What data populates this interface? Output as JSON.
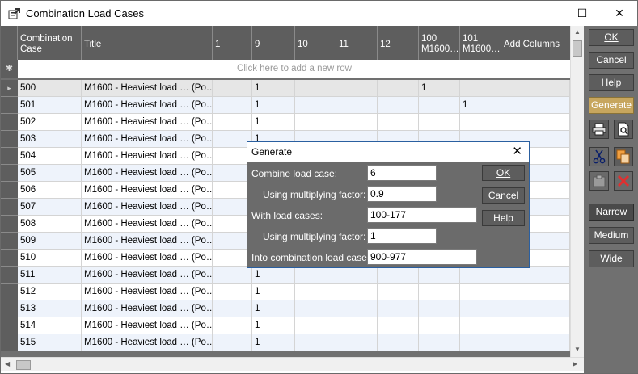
{
  "window": {
    "title": "Combination Load Cases",
    "minimize": "—",
    "maximize": "☐",
    "close": "✕"
  },
  "grid": {
    "columns": [
      "Combination Case",
      "Title",
      "1",
      "9",
      "10",
      "11",
      "12",
      "100 M1600…",
      "101 M1600…",
      "Add Columns"
    ],
    "new_row_placeholder": "Click here to add a new row",
    "new_row_marker": "✱",
    "current_row_marker": "▸",
    "rows": [
      {
        "case": "500",
        "title": "M1600 - Heaviest load … (Po…",
        "c1": "",
        "c9": "1",
        "c10": "",
        "c11": "",
        "c12": "",
        "c100": "1",
        "c101": ""
      },
      {
        "case": "501",
        "title": "M1600 - Heaviest load … (Po…",
        "c1": "",
        "c9": "1",
        "c10": "",
        "c11": "",
        "c12": "",
        "c100": "",
        "c101": "1"
      },
      {
        "case": "502",
        "title": "M1600 - Heaviest load … (Po…",
        "c1": "",
        "c9": "1",
        "c10": "",
        "c11": "",
        "c12": "",
        "c100": "",
        "c101": ""
      },
      {
        "case": "503",
        "title": "M1600 - Heaviest load … (Po…",
        "c1": "",
        "c9": "1",
        "c10": "",
        "c11": "",
        "c12": "",
        "c100": "",
        "c101": ""
      },
      {
        "case": "504",
        "title": "M1600 - Heaviest load … (Po…",
        "c1": "",
        "c9": "",
        "c10": "",
        "c11": "",
        "c12": "",
        "c100": "",
        "c101": ""
      },
      {
        "case": "505",
        "title": "M1600 - Heaviest load … (Po…",
        "c1": "",
        "c9": "",
        "c10": "",
        "c11": "",
        "c12": "",
        "c100": "",
        "c101": ""
      },
      {
        "case": "506",
        "title": "M1600 - Heaviest load … (Po…",
        "c1": "",
        "c9": "",
        "c10": "",
        "c11": "",
        "c12": "",
        "c100": "",
        "c101": ""
      },
      {
        "case": "507",
        "title": "M1600 - Heaviest load … (Po…",
        "c1": "",
        "c9": "",
        "c10": "",
        "c11": "",
        "c12": "",
        "c100": "",
        "c101": ""
      },
      {
        "case": "508",
        "title": "M1600 - Heaviest load … (Po…",
        "c1": "",
        "c9": "",
        "c10": "",
        "c11": "",
        "c12": "",
        "c100": "",
        "c101": ""
      },
      {
        "case": "509",
        "title": "M1600 - Heaviest load … (Po…",
        "c1": "",
        "c9": "",
        "c10": "",
        "c11": "",
        "c12": "",
        "c100": "",
        "c101": ""
      },
      {
        "case": "510",
        "title": "M1600 - Heaviest load … (Po…",
        "c1": "",
        "c9": "",
        "c10": "",
        "c11": "",
        "c12": "",
        "c100": "",
        "c101": ""
      },
      {
        "case": "511",
        "title": "M1600 - Heaviest load … (Po…",
        "c1": "",
        "c9": "1",
        "c10": "",
        "c11": "",
        "c12": "",
        "c100": "",
        "c101": ""
      },
      {
        "case": "512",
        "title": "M1600 - Heaviest load … (Po…",
        "c1": "",
        "c9": "1",
        "c10": "",
        "c11": "",
        "c12": "",
        "c100": "",
        "c101": ""
      },
      {
        "case": "513",
        "title": "M1600 - Heaviest load … (Po…",
        "c1": "",
        "c9": "1",
        "c10": "",
        "c11": "",
        "c12": "",
        "c100": "",
        "c101": ""
      },
      {
        "case": "514",
        "title": "M1600 - Heaviest load … (Po…",
        "c1": "",
        "c9": "1",
        "c10": "",
        "c11": "",
        "c12": "",
        "c100": "",
        "c101": ""
      },
      {
        "case": "515",
        "title": "M1600 - Heaviest load … (Po…",
        "c1": "",
        "c9": "1",
        "c10": "",
        "c11": "",
        "c12": "",
        "c100": "",
        "c101": ""
      }
    ]
  },
  "side": {
    "ok": "OK",
    "cancel": "Cancel",
    "help": "Help",
    "generate": "Generate",
    "narrow": "Narrow",
    "medium": "Medium",
    "wide": "Wide"
  },
  "dialog": {
    "title": "Generate",
    "close": "✕",
    "combine_label": "Combine load case:",
    "combine_value": "6",
    "mult1_label": "Using multiplying factor:",
    "mult1_value": "0.9",
    "with_label": "With load cases:",
    "with_value": "100-177",
    "mult2_label": "Using multiplying factor:",
    "mult2_value": "1",
    "into_label": "Into combination load cases:",
    "into_value": "900-977",
    "ok": "OK",
    "cancel": "Cancel",
    "help": "Help"
  },
  "colors": {
    "grid_bg": "#707070",
    "header_bg": "#5e5e5e",
    "generate_accent": "#c7a65e",
    "dialog_border": "#2a5fa0",
    "delete_red": "#e03030"
  },
  "icons": [
    "app-icon",
    "print-icon",
    "print-preview-icon",
    "cut-icon",
    "copy-icon",
    "paste-icon",
    "delete-icon"
  ]
}
